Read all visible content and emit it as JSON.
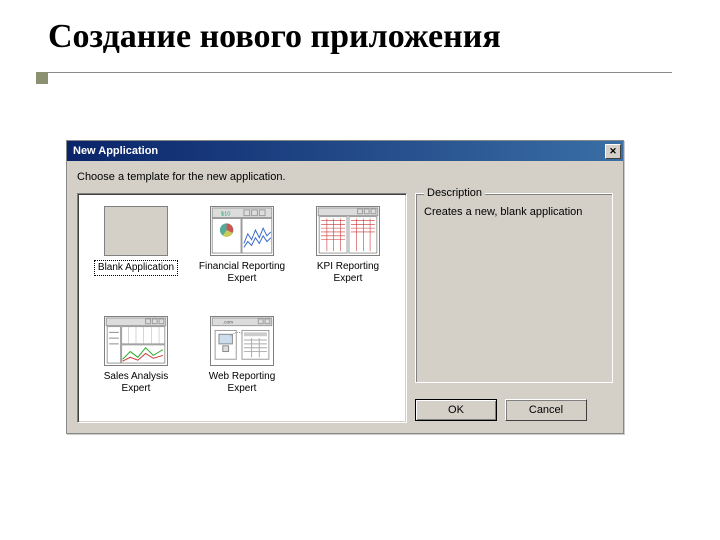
{
  "slide": {
    "title": "Создание нового приложения"
  },
  "dialog": {
    "title": "New Application",
    "instruction": "Choose a template for the new application.",
    "groupbox_title": "Description",
    "description_text": "Creates a new, blank application",
    "ok_label": "OK",
    "cancel_label": "Cancel"
  },
  "templates": [
    {
      "id": "blank",
      "label": "Blank Application",
      "selected": true
    },
    {
      "id": "financial",
      "label": "Financial Reporting Expert",
      "selected": false
    },
    {
      "id": "kpi",
      "label": "KPI Reporting Expert",
      "selected": false
    },
    {
      "id": "sales",
      "label": "Sales Analysis Expert",
      "selected": false
    },
    {
      "id": "web",
      "label": "Web Reporting Expert",
      "selected": false
    }
  ]
}
